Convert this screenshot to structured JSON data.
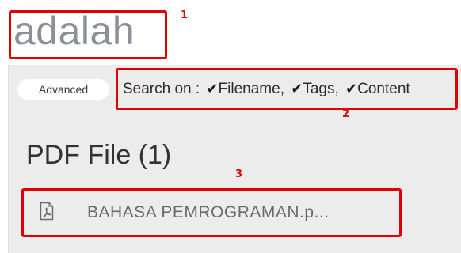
{
  "search": {
    "term": "adalah",
    "advanced_label": "Advanced",
    "search_on_label": "Search on :",
    "filters": [
      "Filename,",
      "Tags,",
      "Content"
    ]
  },
  "results": {
    "section_title": "PDF File (1)",
    "files": [
      {
        "name": "BAHASA PEMROGRAMAN.p...",
        "icon": "pdf-file-icon"
      }
    ]
  },
  "annotations": {
    "labels": [
      "1",
      "2",
      "3"
    ],
    "color": "#e00000"
  },
  "colors": {
    "panel_bg": "#ececec",
    "search_term": "#8a8f98"
  }
}
